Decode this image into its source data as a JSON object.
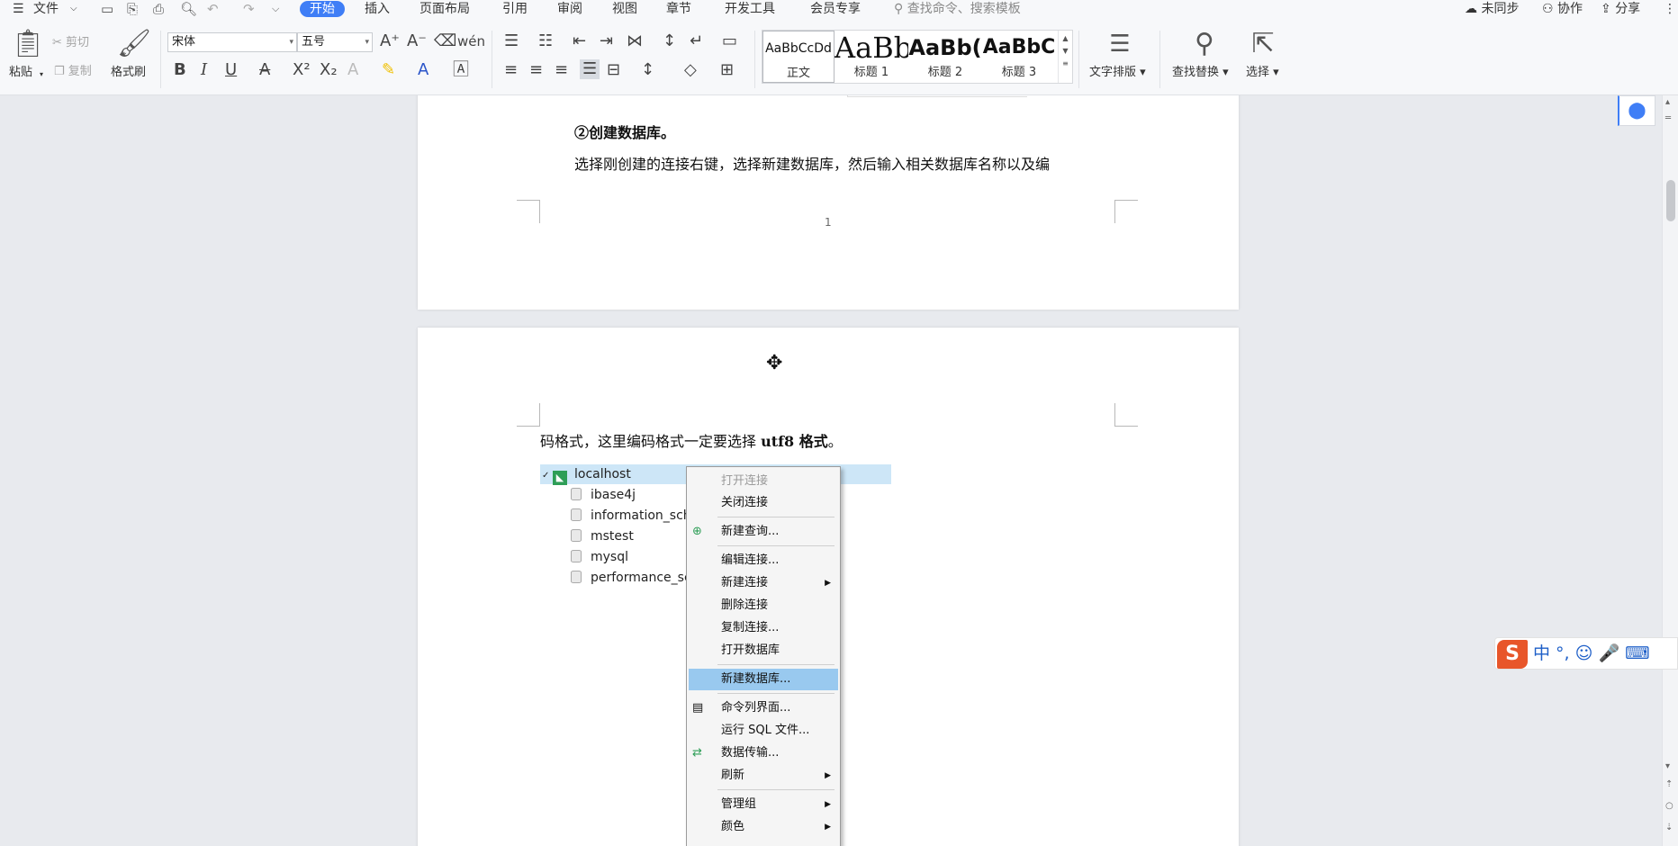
{
  "ribbon": {
    "menu": {
      "file": "文件",
      "tabs": [
        "开始",
        "插入",
        "页面布局",
        "引用",
        "审阅",
        "视图",
        "章节",
        "开发工具",
        "会员专享"
      ],
      "search_placeholder": "查找命令、搜索模板",
      "right": [
        "未同步",
        "协作",
        "分享"
      ]
    },
    "clipboard": {
      "paste": "粘贴",
      "cut": "剪切",
      "copy": "复制",
      "format_painter": "格式刷"
    },
    "font": {
      "name": "宋体",
      "size": "五号"
    },
    "styles": [
      {
        "preview": "AaBbCcDd",
        "name": "正文"
      },
      {
        "preview": "AaBb",
        "name": "标题 1"
      },
      {
        "preview": "AaBb(",
        "name": "标题 2"
      },
      {
        "preview": "AaBbC",
        "name": "标题 3"
      }
    ],
    "layout": "文字排版",
    "find_replace": "查找替换",
    "select": "选择"
  },
  "document": {
    "page1": {
      "heading": "②创建数据库。",
      "para": "选择刚创建的连接右键，选择新建数据库，然后输入相关数据库名称以及编",
      "page_number": "1"
    },
    "page2": {
      "para_prefix": "码格式，这里编码格式一定要选择 ",
      "para_bold": "utf8 格式",
      "para_suffix": "。",
      "tree": {
        "connection": "localhost",
        "databases": [
          "ibase4j",
          "information_sch",
          "mstest",
          "mysql",
          "performance_sc"
        ]
      },
      "context_menu": [
        "打开连接",
        "关闭连接",
        "新建查询...",
        "编辑连接...",
        "新建连接",
        "删除连接",
        "复制连接...",
        "打开数据库",
        "新建数据库...",
        "命令列界面...",
        "运行 SQL 文件...",
        "数据传输...",
        "刷新",
        "管理组",
        "颜色"
      ]
    }
  },
  "ime": {
    "logo": "S",
    "text": "中 °, ☺ 🎤 ⌨"
  },
  "colors": {
    "accent": "#3f7ef6",
    "highlight": "#99c9ef",
    "tree_selected": "#cde6f7"
  }
}
